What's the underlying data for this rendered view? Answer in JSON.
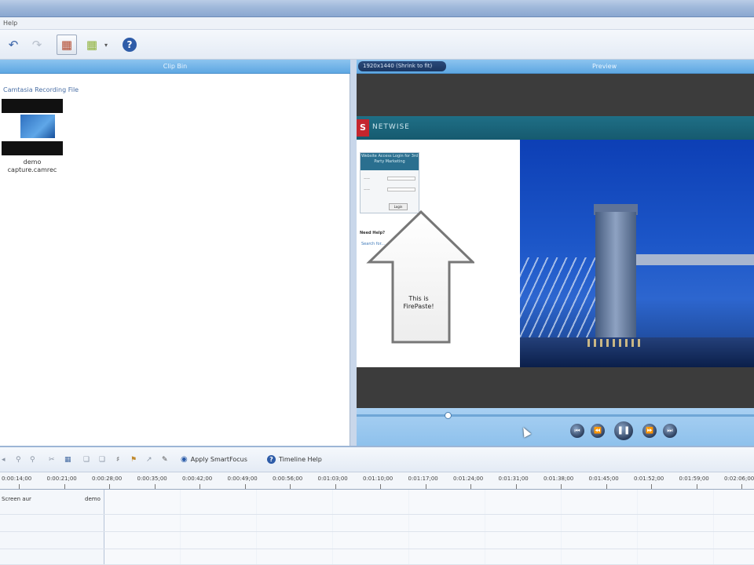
{
  "menu": {
    "help": "Help"
  },
  "toolbar": {
    "icons": [
      "undo-icon",
      "redo-icon",
      "clipboard-icon",
      "folder-icon",
      "help-icon"
    ]
  },
  "clip_bin": {
    "header": "Clip Bin",
    "section_label": "Camtasia Recording File",
    "clip_name": "demo capture.camrec"
  },
  "preview": {
    "header": "Preview",
    "dropdown": "1920x1440 (Shrink to fit)",
    "site_name": "NETWISE",
    "login_title": "Website Access Login for 3rd Party Marketing",
    "need_help": "Need Help?",
    "need_help_link": "Search for...",
    "login_button": "Login",
    "arrow_text": "This is FirePaste!"
  },
  "player": {
    "buttons": [
      "skip-back",
      "rewind",
      "pause",
      "fast-forward",
      "skip-forward"
    ],
    "position": 0.23
  },
  "timeline_toolbar": {
    "apply_smartfocus": "Apply SmartFocus",
    "timeline_help": "Timeline Help"
  },
  "ruler": [
    "0:00:14;00",
    "0:00:21;00",
    "0:00:28;00",
    "0:00:35;00",
    "0:00:42;00",
    "0:00:49;00",
    "0:00:56;00",
    "0:01:03;00",
    "0:01:10;00",
    "0:01:17;00",
    "0:01:24;00",
    "0:01:31;00",
    "0:01:38;00",
    "0:01:45;00",
    "0:01:52;00",
    "0:01:59;00",
    "0:02:06;00"
  ],
  "tracks": {
    "track1_name": "Screen aur",
    "track1_clip": "demo"
  },
  "colors": {
    "accent": "#5ea7e2",
    "preview_bg": "#3c3c3c"
  }
}
